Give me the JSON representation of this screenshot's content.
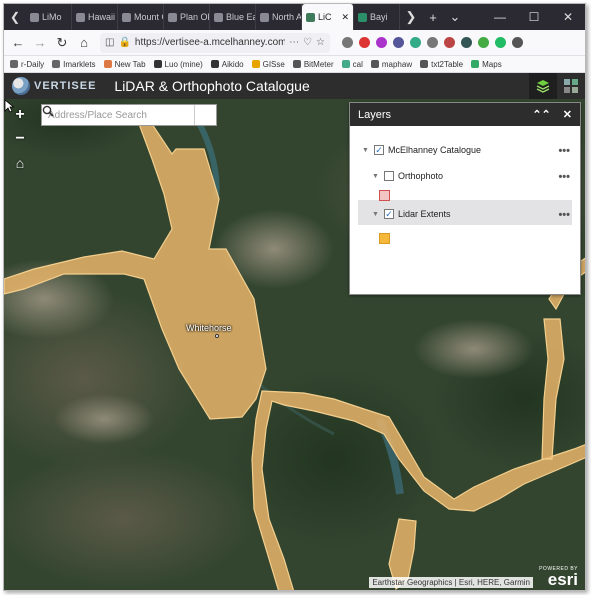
{
  "browser": {
    "tabs": [
      {
        "label": "LiMo",
        "color": "#8a8a95"
      },
      {
        "label": "Hawaii Lo",
        "color": "#8a8a95"
      },
      {
        "label": "Mount G",
        "color": "#8a8a95"
      },
      {
        "label": "Plan Okla",
        "color": "#8a8a95"
      },
      {
        "label": "Blue Earth",
        "color": "#8a8a95"
      },
      {
        "label": "North Ari",
        "color": "#8a8a95"
      },
      {
        "label": "LiC",
        "color": "#3f7a5a",
        "active": true
      },
      {
        "label": "Bayi",
        "color": "#2b8f6a"
      }
    ],
    "url": "https://vertisee-a.mcelhanney.com",
    "bookmarks": [
      {
        "label": "r-Daily",
        "color": "#666"
      },
      {
        "label": "Imarklets",
        "color": "#666"
      },
      {
        "label": "New Tab",
        "color": "#d74"
      },
      {
        "label": "Luo (mine)",
        "color": "#333"
      },
      {
        "label": "Aikido",
        "color": "#333"
      },
      {
        "label": "GISse",
        "color": "#e6a400"
      },
      {
        "label": "BitMeter",
        "color": "#555"
      },
      {
        "label": "cal",
        "color": "#4a8"
      },
      {
        "label": "maphaw",
        "color": "#555"
      },
      {
        "label": "txt2Table",
        "color": "#555"
      },
      {
        "label": "Maps",
        "color": "#3a6"
      }
    ],
    "extension_colors": [
      "#777",
      "#d33",
      "#a3c",
      "#559",
      "#3a8",
      "#777",
      "#b44",
      "#355",
      "#4a4",
      "#2b6",
      "#555"
    ]
  },
  "app": {
    "logo_text": "VERTISEE",
    "title": "LiDAR & Orthophoto Catalogue"
  },
  "search": {
    "placeholder": "Address/Place Search"
  },
  "map": {
    "city_label": "Whitehorse",
    "attribution": "Earthstar Geographics | Esri, HERE, Garmin",
    "esri_powered": "POWERED BY",
    "esri_word": "esri"
  },
  "layers_panel": {
    "title": "Layers",
    "items": [
      {
        "label": "McElhanney Catalogue",
        "checked": true
      },
      {
        "label": "Orthophoto",
        "checked": false,
        "swatch_color": "#f2c4c4",
        "swatch_border": "#d05050"
      },
      {
        "label": "Lidar Extents",
        "checked": true,
        "swatch_color": "#f5b83a",
        "swatch_border": "#d89a20"
      }
    ]
  },
  "colors": {
    "extent_fill": "#e8b46a",
    "extent_stroke": "#f3cf8e",
    "app_header": "#2d2d2d"
  }
}
